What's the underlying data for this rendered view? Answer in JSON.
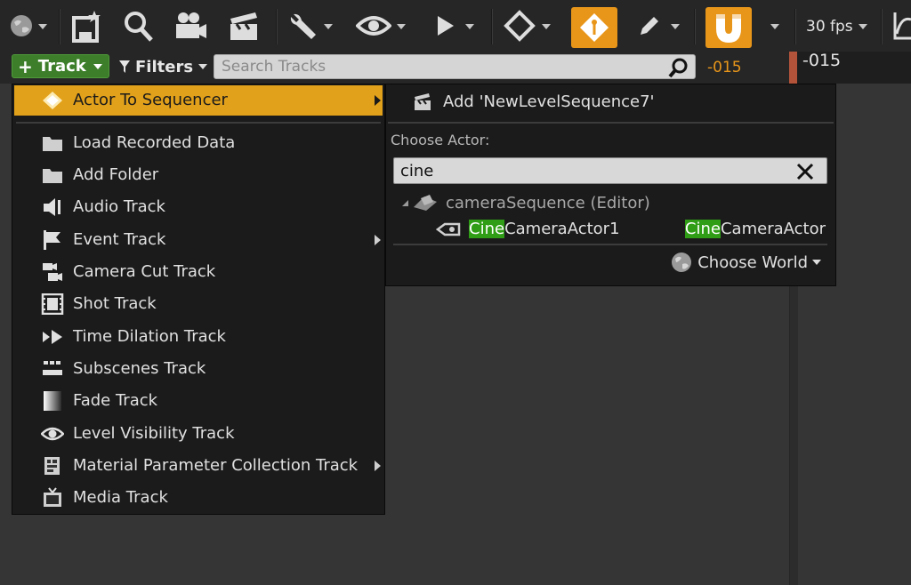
{
  "toolbar": {
    "fps_label": "30 fps",
    "icons": [
      "world-icon",
      "save-icon",
      "search-icon",
      "camera-icon",
      "clapperboard-icon",
      "wrench-icon",
      "eye-icon",
      "play-icon",
      "key-diamond-icon",
      "auto-key-icon",
      "pencil-icon",
      "magnet-icon",
      "graph-icon"
    ]
  },
  "row2": {
    "track_label": "Track",
    "filters_label": "Filters",
    "search_placeholder": "Search Tracks",
    "time_current": "-015",
    "time_panel": "-015"
  },
  "menu": {
    "items": [
      {
        "label": "Actor To Sequencer",
        "icon": "actor-diamond-icon",
        "submenu": true,
        "highlighted": true
      },
      {
        "label": "Load Recorded Data",
        "icon": "folder-icon",
        "submenu": false
      },
      {
        "label": "Add Folder",
        "icon": "folder-icon",
        "submenu": false
      },
      {
        "label": "Audio Track",
        "icon": "speaker-icon",
        "submenu": false
      },
      {
        "label": "Event Track",
        "icon": "flag-icon",
        "submenu": true
      },
      {
        "label": "Camera Cut Track",
        "icon": "camera-cut-icon",
        "submenu": false
      },
      {
        "label": "Shot Track",
        "icon": "film-strip-icon",
        "submenu": false
      },
      {
        "label": "Time Dilation Track",
        "icon": "time-dilation-icon",
        "submenu": false
      },
      {
        "label": "Subscenes Track",
        "icon": "subscenes-icon",
        "submenu": false
      },
      {
        "label": "Fade Track",
        "icon": "fade-gradient-icon",
        "submenu": false
      },
      {
        "label": "Level Visibility Track",
        "icon": "eye-icon",
        "submenu": false
      },
      {
        "label": "Material Parameter Collection Track",
        "icon": "material-collection-icon",
        "submenu": true
      },
      {
        "label": "Media Track",
        "icon": "media-tv-icon",
        "submenu": false
      }
    ]
  },
  "submenu": {
    "add_label": "Add 'NewLevelSequence7'",
    "choose_actor_label": "Choose Actor:",
    "search_value": "cine",
    "tree_group": "cameraSequence (Editor)",
    "actor_name_match": "Cine",
    "actor_name_rest": "CameraActor1",
    "actor_class_match": "Cine",
    "actor_class_rest": "CameraActor",
    "choose_world_label": "Choose World"
  },
  "colors": {
    "accent_orange": "#e2a11a",
    "track_green": "#3d7e2a",
    "highlight_green": "#2f9e16"
  }
}
